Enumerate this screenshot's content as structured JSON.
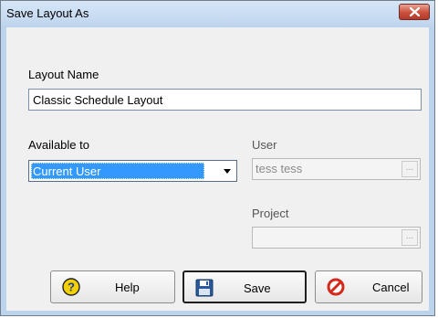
{
  "window": {
    "title": "Save Layout As"
  },
  "layout_name": {
    "label": "Layout Name",
    "value": "Classic Schedule Layout"
  },
  "available_to": {
    "label": "Available to",
    "selected": "Current User"
  },
  "user": {
    "label": "User",
    "value": "tess tess",
    "browse_label": "..."
  },
  "project": {
    "label": "Project",
    "value": "",
    "browse_label": "..."
  },
  "buttons": {
    "help": "Help",
    "save": "Save",
    "cancel": "Cancel"
  },
  "colors": {
    "selection": "#3399ff",
    "titlebar": "#bfd5ee",
    "close_button": "#c9503c",
    "help_icon": "#f3d100",
    "save_icon": "#2a5a9c",
    "cancel_icon": "#d42a1c"
  },
  "icons": {
    "close": "close-icon",
    "dropdown": "chevron-down-icon",
    "help": "help-icon",
    "save": "floppy-disk-icon",
    "cancel": "cancel-icon"
  }
}
